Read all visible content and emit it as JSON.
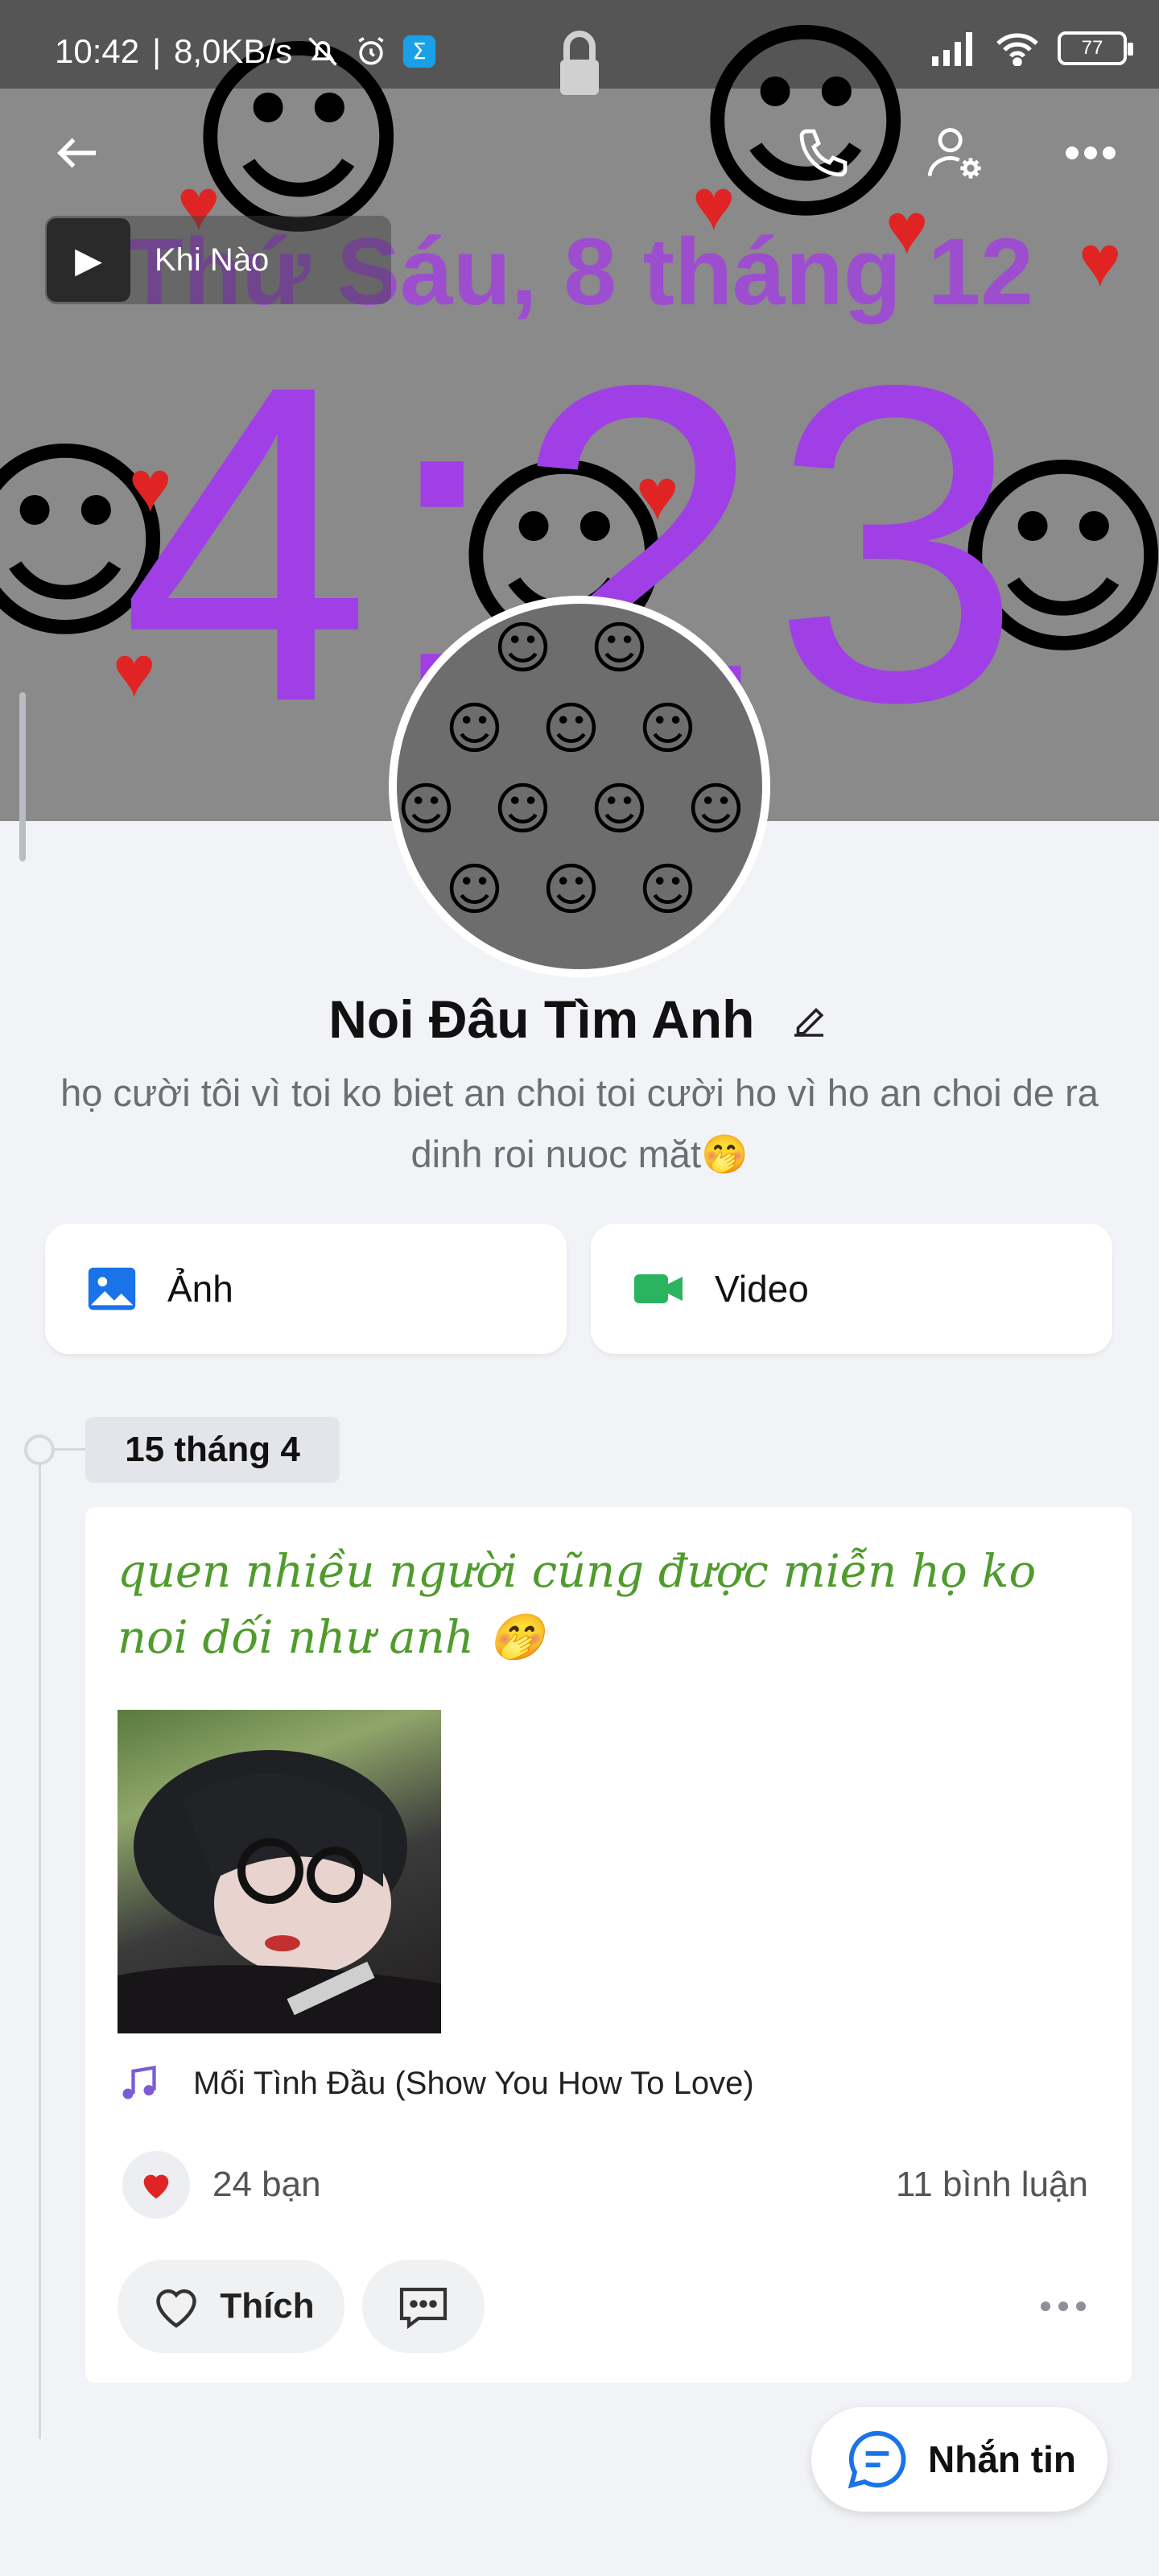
{
  "status_bar": {
    "time": "10:42",
    "network_speed": "8,0KB/s",
    "battery_level": "77",
    "icons": [
      "bell-off-icon",
      "alarm-icon",
      "sigma-app-icon",
      "signal-icon",
      "wifi-icon",
      "battery-icon"
    ]
  },
  "cover": {
    "lockscreen_date": "Thứ Sáu, 8 tháng 12",
    "lockscreen_time": "4:23"
  },
  "header": {
    "back_icon": "arrow-left-icon",
    "call_icon": "phone-icon",
    "profile_settings_icon": "user-gear-icon",
    "more_icon": "more-horizontal-icon"
  },
  "profile_music": {
    "title": "Khi Nào"
  },
  "profile": {
    "name": "Noi Đâu Tìm Anh",
    "bio": "họ cười tôi vì toi ko biet an choi toi cười ho vì ho an choi de ra dinh roi nuoc măt🤭"
  },
  "media_buttons": {
    "photos_label": "Ảnh",
    "video_label": "Video"
  },
  "timeline": {
    "date": "15 tháng 4"
  },
  "post": {
    "text": "quen nhiều người cũng được miễn họ ko noi dối như anh 🤭",
    "song": "Mối Tình Đầu (Show You How To Love)",
    "likes": "24 bạn",
    "comments": "11 bình luận",
    "like_button_label": "Thích"
  },
  "fab": {
    "label": "Nhắn tin"
  },
  "colors": {
    "accent_blue": "#1a73e8",
    "video_green": "#2bb45f",
    "post_text_green": "#4f9b2c",
    "lockscreen_purple": "#a03fe6",
    "heart_red": "#e02424"
  }
}
